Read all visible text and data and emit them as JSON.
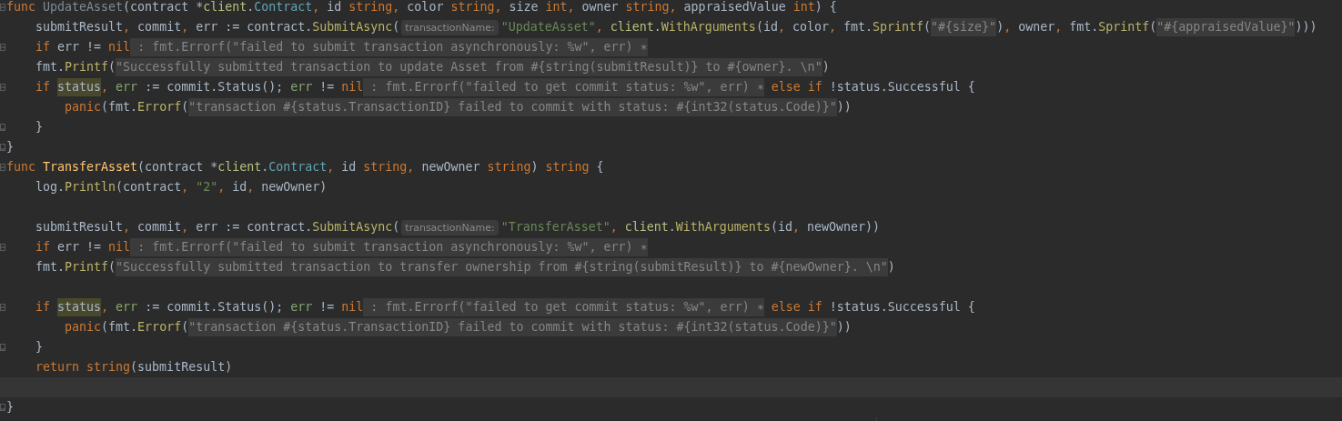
{
  "editor": {
    "lines": [
      {
        "gutter_icon": {
          "kind": "fold-start"
        },
        "tokens": [
          {
            "kind": "kw",
            "text": "func "
          },
          {
            "kind": "unused",
            "text": "UpdateAsset"
          },
          {
            "kind": "plain",
            "text": "(contract *"
          },
          {
            "kind": "pkg",
            "text": "client"
          },
          {
            "kind": "plain",
            "text": "."
          },
          {
            "kind": "type",
            "text": "Contract"
          },
          {
            "kind": "kw",
            "text": ", "
          },
          {
            "kind": "plain",
            "text": "id "
          },
          {
            "kind": "kw",
            "text": "string, "
          },
          {
            "kind": "plain",
            "text": "color "
          },
          {
            "kind": "kw",
            "text": "string, "
          },
          {
            "kind": "plain",
            "text": "size "
          },
          {
            "kind": "kw",
            "text": "int, "
          },
          {
            "kind": "plain",
            "text": "owner "
          },
          {
            "kind": "kw",
            "text": "string, "
          },
          {
            "kind": "plain",
            "text": "appraisedValue "
          },
          {
            "kind": "kw",
            "text": "int"
          },
          {
            "kind": "plain",
            "text": ") {"
          }
        ]
      },
      {
        "tokens": [
          {
            "kind": "plain",
            "text": "    submitResult"
          },
          {
            "kind": "kw",
            "text": ", "
          },
          {
            "kind": "plain",
            "text": "commit"
          },
          {
            "kind": "kw",
            "text": ", "
          },
          {
            "kind": "plain",
            "text": "err := contract."
          },
          {
            "kind": "call",
            "text": "SubmitAsync"
          },
          {
            "kind": "plain",
            "text": "("
          },
          {
            "kind": "hint",
            "text": "transactionName:"
          },
          {
            "kind": "str",
            "text": "\"UpdateAsset\""
          },
          {
            "kind": "kw",
            "text": ", "
          },
          {
            "kind": "pkg",
            "text": "client"
          },
          {
            "kind": "plain",
            "text": "."
          },
          {
            "kind": "call",
            "text": "WithArguments"
          },
          {
            "kind": "plain",
            "text": "(id"
          },
          {
            "kind": "kw",
            "text": ", "
          },
          {
            "kind": "plain",
            "text": "color"
          },
          {
            "kind": "kw",
            "text": ", "
          },
          {
            "kind": "plain",
            "text": "fmt."
          },
          {
            "kind": "call",
            "text": "Sprintf"
          },
          {
            "kind": "plain",
            "text": "("
          },
          {
            "kind": "fold",
            "text": "\"#{size}\""
          },
          {
            "kind": "plain",
            "text": ")"
          },
          {
            "kind": "kw",
            "text": ", "
          },
          {
            "kind": "plain",
            "text": "owner"
          },
          {
            "kind": "kw",
            "text": ", "
          },
          {
            "kind": "plain",
            "text": "fmt."
          },
          {
            "kind": "call",
            "text": "Sprintf"
          },
          {
            "kind": "plain",
            "text": "("
          },
          {
            "kind": "fold",
            "text": "\"#{appraisedValue}\""
          },
          {
            "kind": "plain",
            "text": ")))"
          }
        ]
      },
      {
        "gutter_icon": {
          "kind": "fold-start"
        },
        "tokens": [
          {
            "kind": "kw",
            "text": "    if "
          },
          {
            "kind": "plain",
            "text": "err != "
          },
          {
            "kind": "kw",
            "text": "nil"
          },
          {
            "kind": "fold",
            "text": " : fmt.Errorf(\"failed to submit transaction asynchronously: %w\", err) ∗"
          }
        ]
      },
      {
        "tokens": [
          {
            "kind": "plain",
            "text": "    fmt."
          },
          {
            "kind": "call",
            "text": "Printf"
          },
          {
            "kind": "plain",
            "text": "("
          },
          {
            "kind": "fold",
            "text": "\"Successfully submitted transaction to update Asset from #{string(submitResult)} to #{owner}. \\n\""
          },
          {
            "kind": "plain",
            "text": ")"
          }
        ]
      },
      {
        "gutter_icon": {
          "kind": "fold-start"
        },
        "tokens": [
          {
            "kind": "kw",
            "text": "    if "
          },
          {
            "kind": "hl",
            "text": "status"
          },
          {
            "kind": "kw",
            "text": ", "
          },
          {
            "kind": "local",
            "text": "err"
          },
          {
            "kind": "plain",
            "text": " := commit.Status(); "
          },
          {
            "kind": "local",
            "text": "err"
          },
          {
            "kind": "plain",
            "text": " != "
          },
          {
            "kind": "kw",
            "text": "nil"
          },
          {
            "kind": "fold",
            "text": " : fmt.Errorf(\"failed to get commit status: %w\", err) ∗"
          },
          {
            "kind": "kw",
            "text": " else if "
          },
          {
            "kind": "plain",
            "text": "!status.Successful {"
          }
        ]
      },
      {
        "tokens": [
          {
            "kind": "kw",
            "text": "        panic"
          },
          {
            "kind": "plain",
            "text": "(fmt."
          },
          {
            "kind": "call",
            "text": "Errorf"
          },
          {
            "kind": "plain",
            "text": "("
          },
          {
            "kind": "fold",
            "text": "\"transaction #{status.TransactionID} failed to commit with status: #{int32(status.Code)}\""
          },
          {
            "kind": "plain",
            "text": "))"
          }
        ]
      },
      {
        "gutter_icon": {
          "kind": "fold-end"
        },
        "tokens": [
          {
            "kind": "plain",
            "text": "    }"
          }
        ]
      },
      {
        "gutter_icon": {
          "kind": "fold-end"
        },
        "tokens": [
          {
            "kind": "plain",
            "text": "}"
          }
        ]
      },
      {
        "gutter_icon": {
          "kind": "fold-start"
        },
        "tokens": [
          {
            "kind": "kw",
            "text": "func "
          },
          {
            "kind": "decl",
            "text": "TransferAsset"
          },
          {
            "kind": "plain",
            "text": "(contract *"
          },
          {
            "kind": "pkg",
            "text": "client"
          },
          {
            "kind": "plain",
            "text": "."
          },
          {
            "kind": "type",
            "text": "Contract"
          },
          {
            "kind": "kw",
            "text": ", "
          },
          {
            "kind": "plain",
            "text": "id "
          },
          {
            "kind": "kw",
            "text": "string, "
          },
          {
            "kind": "plain",
            "text": "newOwner "
          },
          {
            "kind": "kw",
            "text": "string"
          },
          {
            "kind": "plain",
            "text": ") "
          },
          {
            "kind": "kw",
            "text": "string"
          },
          {
            "kind": "plain",
            "text": " {"
          }
        ]
      },
      {
        "tokens": [
          {
            "kind": "plain",
            "text": "    log."
          },
          {
            "kind": "call",
            "text": "Println"
          },
          {
            "kind": "plain",
            "text": "(contract"
          },
          {
            "kind": "kw",
            "text": ", "
          },
          {
            "kind": "str",
            "text": "\"2\""
          },
          {
            "kind": "kw",
            "text": ", "
          },
          {
            "kind": "plain",
            "text": "id"
          },
          {
            "kind": "kw",
            "text": ", "
          },
          {
            "kind": "plain",
            "text": "newOwner)"
          }
        ]
      },
      {
        "kind": "blank"
      },
      {
        "tokens": [
          {
            "kind": "plain",
            "text": "    submitResult"
          },
          {
            "kind": "kw",
            "text": ", "
          },
          {
            "kind": "plain",
            "text": "commit"
          },
          {
            "kind": "kw",
            "text": ", "
          },
          {
            "kind": "plain",
            "text": "err := contract."
          },
          {
            "kind": "call",
            "text": "SubmitAsync"
          },
          {
            "kind": "plain",
            "text": "("
          },
          {
            "kind": "hint",
            "text": "transactionName:"
          },
          {
            "kind": "str",
            "text": "\"TransferAsset\""
          },
          {
            "kind": "kw",
            "text": ", "
          },
          {
            "kind": "pkg",
            "text": "client"
          },
          {
            "kind": "plain",
            "text": "."
          },
          {
            "kind": "call",
            "text": "WithArguments"
          },
          {
            "kind": "plain",
            "text": "(id"
          },
          {
            "kind": "kw",
            "text": ", "
          },
          {
            "kind": "plain",
            "text": "newOwner))"
          }
        ]
      },
      {
        "gutter_icon": {
          "kind": "fold-start"
        },
        "tokens": [
          {
            "kind": "kw",
            "text": "    if "
          },
          {
            "kind": "plain",
            "text": "err != "
          },
          {
            "kind": "kw",
            "text": "nil"
          },
          {
            "kind": "fold",
            "text": " : fmt.Errorf(\"failed to submit transaction asynchronously: %w\", err) ∗"
          }
        ]
      },
      {
        "tokens": [
          {
            "kind": "plain",
            "text": "    fmt."
          },
          {
            "kind": "call",
            "text": "Printf"
          },
          {
            "kind": "plain",
            "text": "("
          },
          {
            "kind": "fold",
            "text": "\"Successfully submitted transaction to transfer ownership from #{string(submitResult)} to #{newOwner}. \\n\""
          },
          {
            "kind": "plain",
            "text": ")"
          }
        ]
      },
      {
        "kind": "blank"
      },
      {
        "gutter_icon": {
          "kind": "fold-start"
        },
        "tokens": [
          {
            "kind": "kw",
            "text": "    if "
          },
          {
            "kind": "hl",
            "text": "status"
          },
          {
            "kind": "kw",
            "text": ", "
          },
          {
            "kind": "local",
            "text": "err"
          },
          {
            "kind": "plain",
            "text": " := commit.Status(); "
          },
          {
            "kind": "local",
            "text": "err"
          },
          {
            "kind": "plain",
            "text": " != "
          },
          {
            "kind": "kw",
            "text": "nil"
          },
          {
            "kind": "fold",
            "text": " : fmt.Errorf(\"failed to get commit status: %w\", err) ∗"
          },
          {
            "kind": "kw",
            "text": " else if "
          },
          {
            "kind": "plain",
            "text": "!status.Successful {"
          }
        ]
      },
      {
        "tokens": [
          {
            "kind": "kw",
            "text": "        panic"
          },
          {
            "kind": "plain",
            "text": "(fmt."
          },
          {
            "kind": "call",
            "text": "Errorf"
          },
          {
            "kind": "plain",
            "text": "("
          },
          {
            "kind": "fold",
            "text": "\"transaction #{status.TransactionID} failed to commit with status: #{int32(status.Code)}\""
          },
          {
            "kind": "plain",
            "text": "))"
          }
        ]
      },
      {
        "gutter_icon": {
          "kind": "fold-end"
        },
        "tokens": [
          {
            "kind": "plain",
            "text": "    }"
          }
        ]
      },
      {
        "tokens": [
          {
            "kind": "kw",
            "text": "    return string"
          },
          {
            "kind": "plain",
            "text": "(submitResult)"
          }
        ]
      },
      {
        "kind": "current-line"
      },
      {
        "gutter_icon": {
          "kind": "fold-end"
        },
        "tokens": [
          {
            "kind": "plain",
            "text": "}"
          }
        ]
      }
    ]
  }
}
